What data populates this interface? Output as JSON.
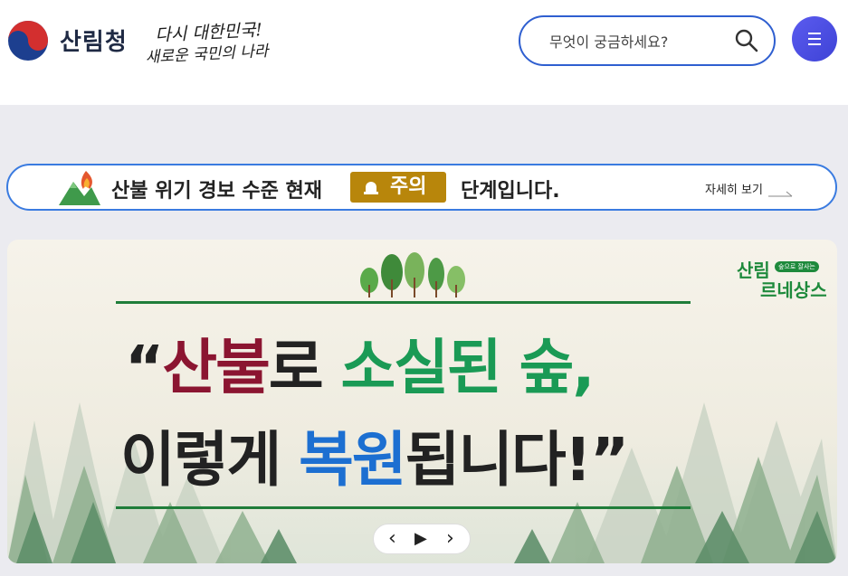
{
  "header": {
    "logo_text": "산림청",
    "slogan_line1": "다시 대한민국!",
    "slogan_line2": "새로운 국민의 나라",
    "search_placeholder": "무엇이 궁금하세요?",
    "menu_icon": "hamburger-icon"
  },
  "alert": {
    "text_before": "산불 위기 경보 수준 현재",
    "level": "주의",
    "text_after": "단계입니다.",
    "more_link": "자세히 보기",
    "level_color": "#b8860b",
    "border_color": "#3a7be0"
  },
  "banner": {
    "brand_line1": "산림",
    "brand_line2": "르네상스",
    "brand_sub": "숲으로 잘사는",
    "headline_line1": {
      "open_quote": "“",
      "part1": "산불",
      "part2": "로 ",
      "part3": "소실된 숲,"
    },
    "headline_line2": {
      "part1": "이렇게 ",
      "part2": "복원",
      "part3": "됩니다!",
      "close_quote": "”"
    },
    "pager": {
      "prev": "‹",
      "play": "▶",
      "next": "›"
    },
    "colors": {
      "red": "#8b1531",
      "green": "#1a9a55",
      "blue": "#1c6fd1"
    }
  }
}
